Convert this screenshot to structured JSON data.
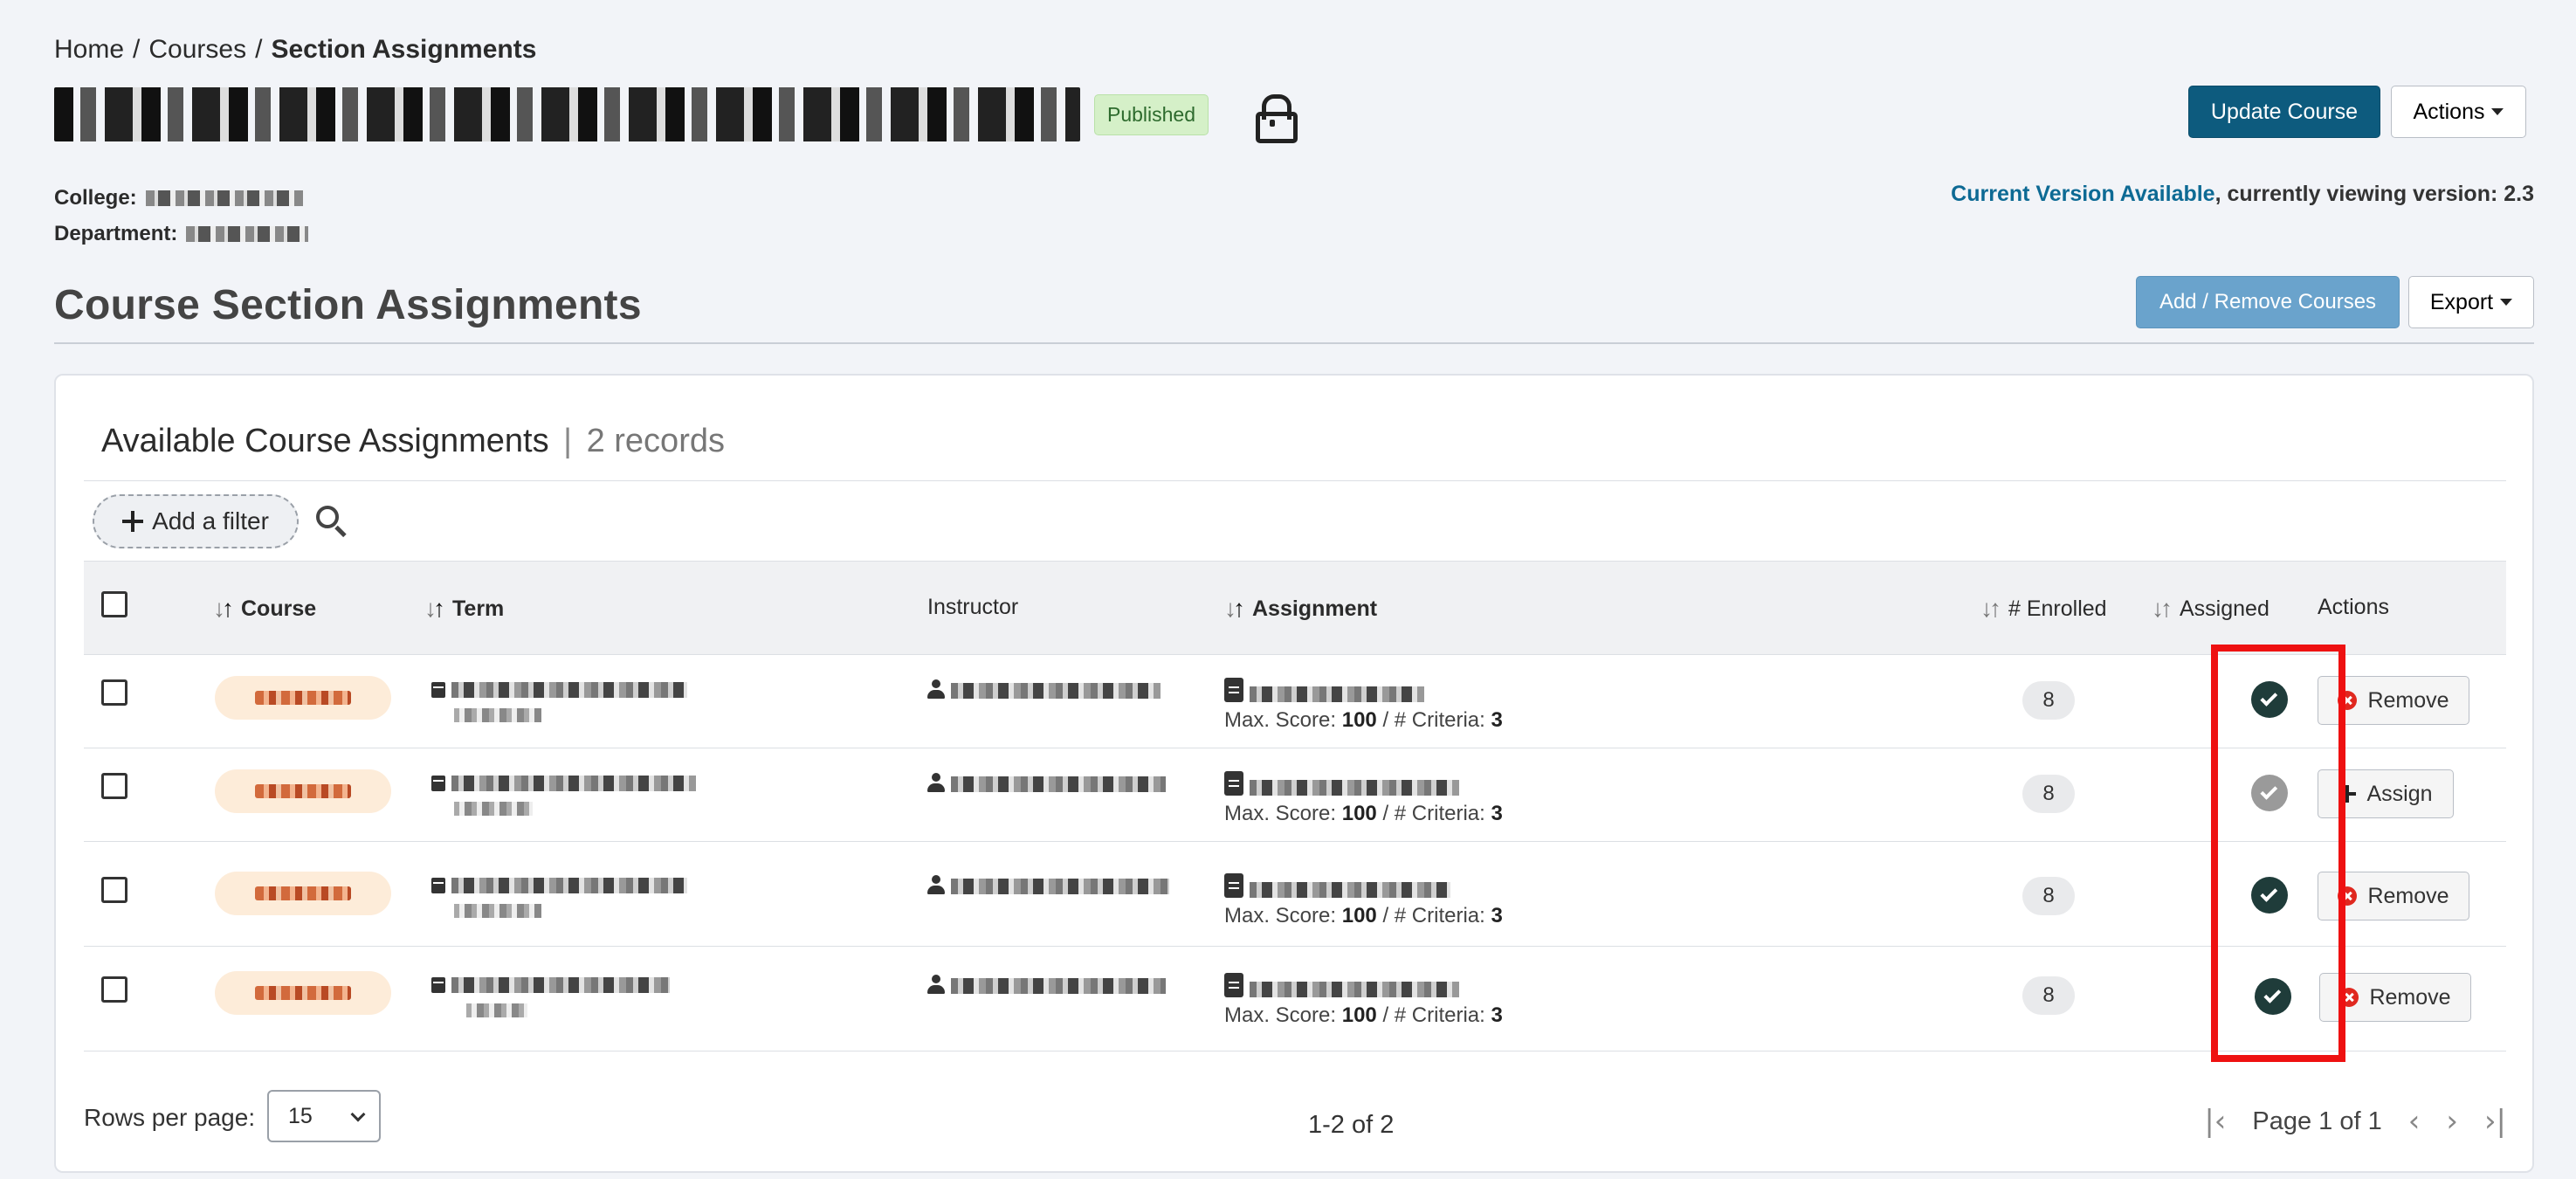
{
  "breadcrumb": {
    "home": "Home",
    "courses": "Courses",
    "current": "Section Assignments",
    "sep": "/"
  },
  "header": {
    "status_badge": "Published",
    "update_button": "Update Course",
    "actions_button": "Actions"
  },
  "meta": {
    "college_label": "College:",
    "department_label": "Department:"
  },
  "version": {
    "link": "Current Version Available",
    "suffix": ", currently viewing version: 2.3"
  },
  "section": {
    "title": "Course Section Assignments",
    "add_remove_button": "Add / Remove Courses",
    "export_button": "Export"
  },
  "card": {
    "title": "Available Course Assignments",
    "separator": "|",
    "record_count": "2 records",
    "filter_button": "Add a filter"
  },
  "table": {
    "columns": {
      "course": "Course",
      "term": "Term",
      "instructor": "Instructor",
      "assignment": "Assignment",
      "enrolled": "# Enrolled",
      "assigned": "Assigned",
      "actions": "Actions"
    },
    "score_label": "Max. Score:",
    "criteria_label": "/ # Criteria:",
    "rows": [
      {
        "max_score": "100",
        "criteria": "3",
        "enrolled": "8",
        "assigned": true,
        "action": "Remove"
      },
      {
        "max_score": "100",
        "criteria": "3",
        "enrolled": "8",
        "assigned": false,
        "action": "Assign"
      },
      {
        "max_score": "100",
        "criteria": "3",
        "enrolled": "8",
        "assigned": true,
        "action": "Remove"
      },
      {
        "max_score": "100",
        "criteria": "3",
        "enrolled": "8",
        "assigned": true,
        "action": "Remove"
      }
    ]
  },
  "footer": {
    "rows_per_page_label": "Rows per page:",
    "rows_per_page_value": "15",
    "range": "1-2 of 2",
    "page_label": "Page 1 of 1"
  },
  "colors": {
    "primary": "#0d5b7e",
    "light_primary": "#6aa3cc",
    "published_bg": "#d5f0c8",
    "assigned_on": "#1f3c3a",
    "assigned_off": "#9a9a9a",
    "highlight": "#ee1111"
  },
  "icons": [
    "lock-icon",
    "caret-down-icon",
    "plus-icon",
    "search-icon",
    "calendar-icon",
    "person-icon",
    "clipboard-icon",
    "check-circle-icon",
    "x-circle-icon",
    "first-page-icon",
    "prev-page-icon",
    "next-page-icon",
    "last-page-icon"
  ]
}
